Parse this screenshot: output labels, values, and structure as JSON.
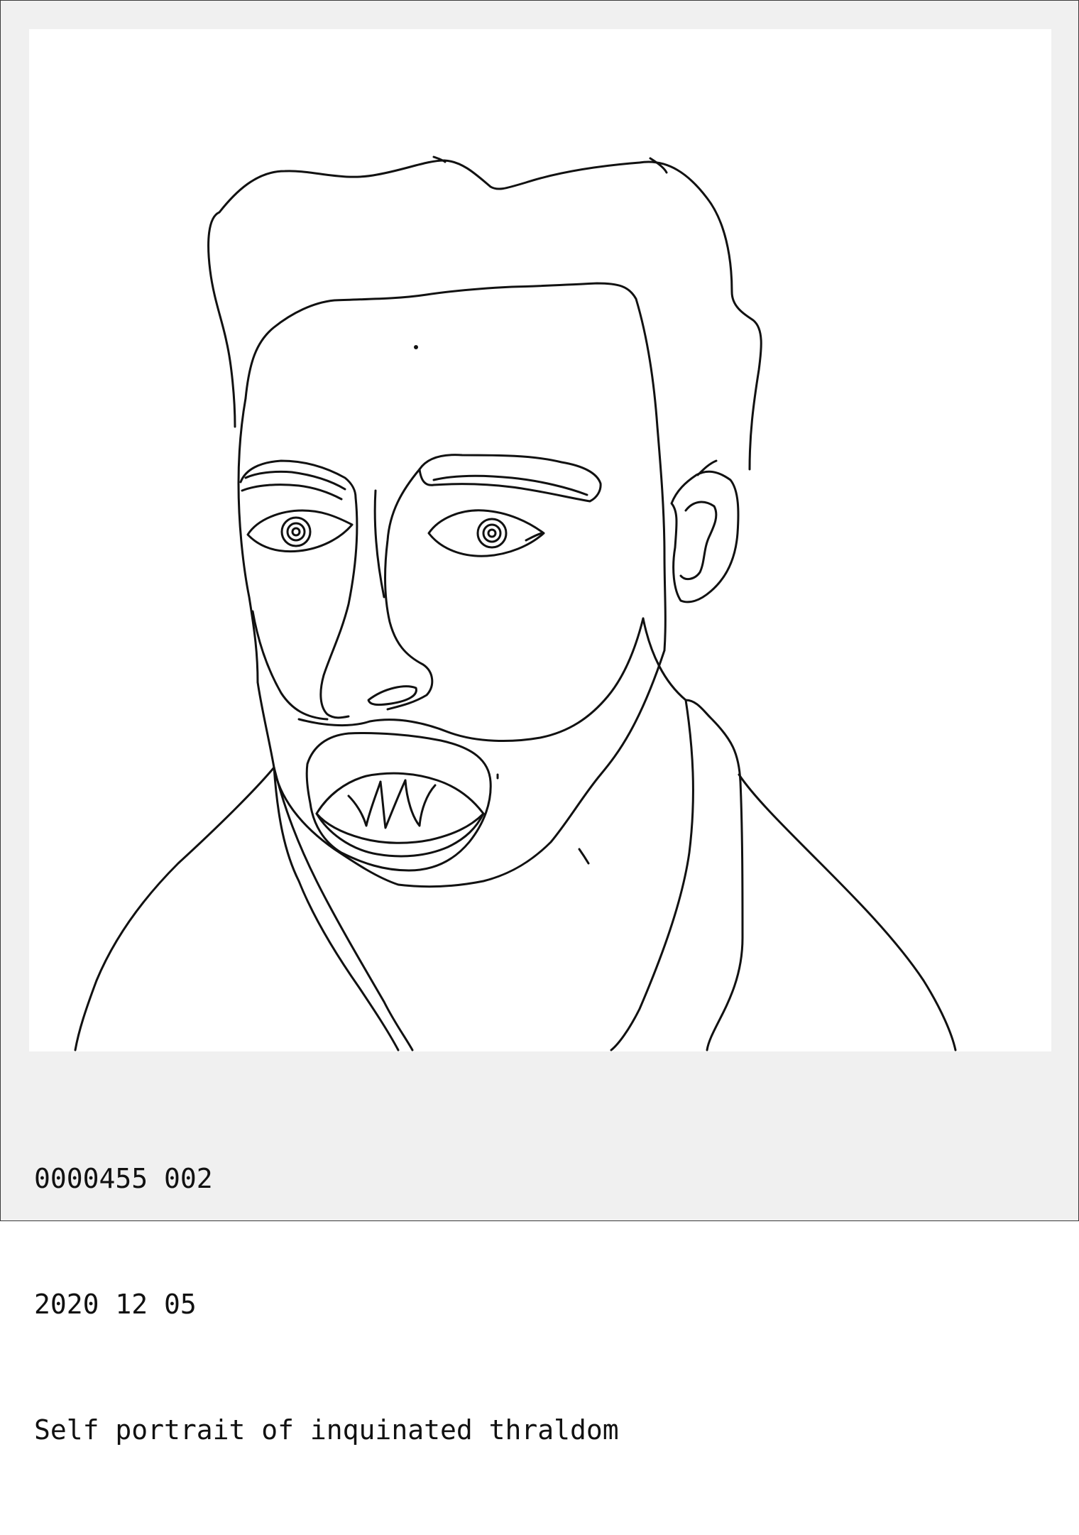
{
  "card": {
    "id_line": "0000455 002",
    "date_line": "2020 12 05",
    "title_line": "Self portrait of inquinated thraldom"
  },
  "colors": {
    "frame_background": "#f0f0f0",
    "canvas_background": "#ffffff",
    "ink": "#111111"
  }
}
